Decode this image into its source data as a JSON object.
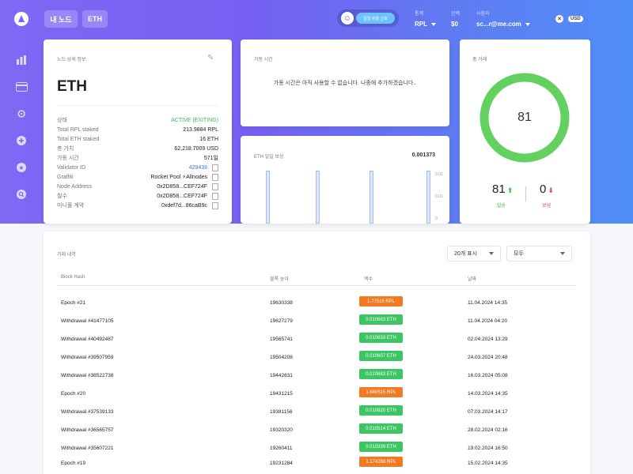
{
  "colors": {
    "accent_start": "#8068f5",
    "accent_end": "#4f8ef7",
    "rpl_badge": "#f27a22",
    "eth_badge": "#3cc663",
    "active": "#3dbb5a",
    "gauge": "#5fd35f"
  },
  "sidebar": {
    "logo": "rocket-logo",
    "items": [
      "chart-icon",
      "wallet-icon",
      "gear-icon",
      "plus-icon",
      "star-icon",
      "search-icon"
    ]
  },
  "topbar": {
    "tab_my_nodes": "내 노드",
    "tab_eth": "ETH",
    "exit_button": "일일 퇴출 신호",
    "network_label": "통계",
    "network_value": "RPL",
    "balance_label": "잔액",
    "balance_value": "$0",
    "user_label": "사용자",
    "user_value": "sc...r@me.com",
    "currency": "USD"
  },
  "node": {
    "title": "노드 상세 정보",
    "name": "ETH",
    "rows": [
      {
        "k": "상태",
        "v": "ACTIVE (EXITING)"
      },
      {
        "k": "Total RPL staked",
        "v": "213.9884 RPL"
      },
      {
        "k": "Total ETH staked",
        "v": "16 ETH"
      },
      {
        "k": "총 가치",
        "v": "62,218.7009 USD"
      },
      {
        "k": "가동 시간",
        "v": "571일"
      },
      {
        "k": "Validator ID",
        "v": "429438"
      },
      {
        "k": "Graffiti",
        "v": "Rocket Pool ⚡Allnodes"
      },
      {
        "k": "Node Address",
        "v": "0x2D858...CEF724F"
      },
      {
        "k": "철수",
        "v": "0x2D858...CEF724F"
      },
      {
        "k": "미니풀 계약",
        "v": "0xdef7d...86caB9c"
      }
    ]
  },
  "uptime": {
    "title": "가동 시간",
    "message": "가동 시간은 아직 사용할 수 없습니다. 나중에 추가하겠습니다.."
  },
  "reward": {
    "title": "ETH 일일 보상",
    "value": "0.001373",
    "ticks": [
      "0.01",
      "0.01",
      "0"
    ]
  },
  "total_tx": {
    "title": "총 거래",
    "total": "81",
    "sent": "81",
    "sent_label": "발송",
    "received": "0",
    "received_label": "보냄"
  },
  "transactions": {
    "title": "거래 내역",
    "page_size": "20개 표시",
    "filter": "모두",
    "headers": [
      "Block Hash",
      "블록 높이",
      "액수",
      "날짜"
    ],
    "rows": [
      {
        "hash": "Epoch #21",
        "height": "19630338",
        "amount": "1.77515 RPL",
        "date": "11.04.2024 14:35"
      },
      {
        "hash": "Withdrawal #41477105",
        "height": "19627279",
        "amount": "0.010663 ETH",
        "date": "11.04.2024 04:20"
      },
      {
        "hash": "Withdrawal #40492487",
        "height": "19565741",
        "amount": "0.010633 ETH",
        "date": "02.04.2024 13:29"
      },
      {
        "hash": "Withdrawal #39507959",
        "height": "19504208",
        "amount": "0.010607 ETH",
        "date": "24.03.2024 20:48"
      },
      {
        "hash": "Withdrawal #38522738",
        "height": "19442631",
        "amount": "0.010683 ETH",
        "date": "16.03.2024 05:08"
      },
      {
        "hash": "Epoch #20",
        "height": "19431215",
        "amount": "1.680515 RPL",
        "date": "14.03.2024 14:35"
      },
      {
        "hash": "Withdrawal #37539133",
        "height": "19381156",
        "amount": "0.010820 ETH",
        "date": "07.03.2024 14:17"
      },
      {
        "hash": "Withdrawal #36565757",
        "height": "19320320",
        "amount": "0.010514 ETH",
        "date": "28.02.2024 02:16"
      },
      {
        "hash": "Withdrawal #35607221",
        "height": "19260411",
        "amount": "0.010339 ETH",
        "date": "19.02.2024 16:50"
      },
      {
        "hash": "Epoch #19",
        "height": "19231284",
        "amount": "1.174288 RPL",
        "date": "15.02.2024 14:35"
      }
    ]
  }
}
